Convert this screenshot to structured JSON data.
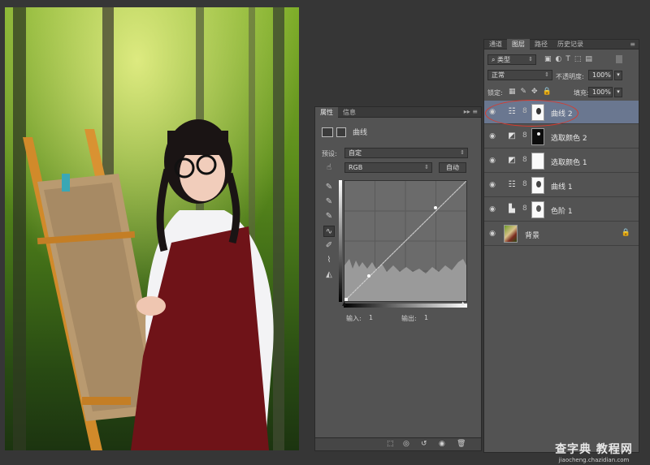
{
  "watermark_top": "",
  "properties": {
    "tabs": [
      "属性",
      "信息"
    ],
    "title": "曲线",
    "preset_label": "预设:",
    "preset_value": "自定",
    "channel_value": "RGB",
    "auto_label": "自动",
    "input_label": "输入:",
    "input_value": "1",
    "output_label": "输出:",
    "output_value": "1"
  },
  "layers": {
    "tabs": [
      "通道",
      "图层",
      "路径",
      "历史记录"
    ],
    "filter_value": "类型",
    "blend_mode": "正常",
    "opacity_label": "不透明度:",
    "opacity_value": "100%",
    "lock_label": "锁定:",
    "fill_label": "填充:",
    "fill_value": "100%",
    "items": [
      {
        "name": "曲线 2",
        "selected": true
      },
      {
        "name": "选取颜色 2"
      },
      {
        "name": "选取颜色 1"
      },
      {
        "name": "曲线 1"
      },
      {
        "name": "色阶 1"
      },
      {
        "name": "背景"
      }
    ]
  },
  "watermark_bottom": {
    "line1": "查字典 教程网",
    "line2": "jiaocheng.chazidian.com"
  },
  "colors": {
    "accent_circle": "#d63b2f",
    "selected_row": "#6a7790"
  }
}
